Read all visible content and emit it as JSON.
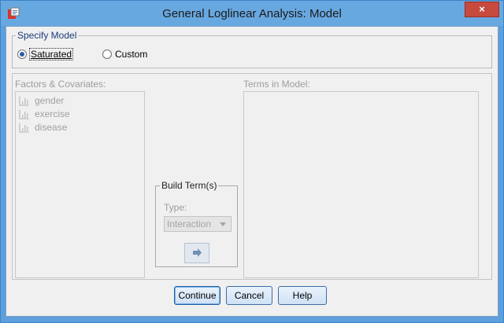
{
  "window": {
    "title": "General Loglinear Analysis: Model",
    "close_label": "×"
  },
  "specify_model": {
    "legend": "Specify Model",
    "saturated": {
      "label": "Saturated",
      "selected": true
    },
    "custom": {
      "label": "Custom",
      "selected": false
    }
  },
  "factors": {
    "label": "Factors & Covariates:",
    "items": [
      "gender",
      "exercise",
      "disease"
    ]
  },
  "terms": {
    "label": "Terms in Model:"
  },
  "build_term": {
    "legend": "Build Term(s)",
    "type_label": "Type:",
    "type_value": "Interaction"
  },
  "buttons": {
    "continue": "Continue",
    "cancel": "Cancel",
    "help": "Help"
  },
  "colors": {
    "titlebar": "#68a8e0",
    "close": "#c74a3f",
    "dialog_bg": "#f0f0f0",
    "button_border": "#3a6ea5"
  },
  "icons": {
    "app": "spss-dialog-icon",
    "variable": "scale-variable-icon",
    "move": "right-arrow-icon"
  }
}
